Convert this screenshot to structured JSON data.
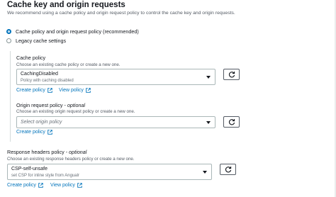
{
  "section": {
    "title": "Cache key and origin requests",
    "description": "We recommend using a cache policy and origin request policy to control the cache key and origin requests."
  },
  "options": {
    "recommended": "Cache policy and origin request policy (recommended)",
    "legacy": "Legacy cache settings"
  },
  "cache_policy": {
    "label": "Cache policy",
    "description": "Choose an existing cache policy or create a new one.",
    "selected": "CachingDisabled",
    "selected_sub": "Policy with caching disabled",
    "create_link": "Create policy",
    "view_link": "View policy"
  },
  "origin_request_policy": {
    "label": "Origin request policy",
    "label_suffix": "optional",
    "description": "Choose an existing origin request policy or create a new one.",
    "placeholder": "Select origin policy",
    "create_link": "Create policy"
  },
  "response_headers_policy": {
    "label": "Response headers policy",
    "label_suffix": "optional",
    "description": "Choose an existing response headers policy or create a new one.",
    "selected": "CSP-self-unsafe",
    "selected_sub": "set CSP for inline style from Angualr",
    "create_link": "Create policy",
    "view_link": "View policy"
  },
  "colors": {
    "link": "#0073bb",
    "radio_selected": "#0073bb",
    "text": "#16191f",
    "muted": "#545b64",
    "border": "#aab7b8"
  },
  "icons": {
    "refresh": "refresh-icon",
    "external": "external-link-icon",
    "caret": "caret-down-icon"
  }
}
